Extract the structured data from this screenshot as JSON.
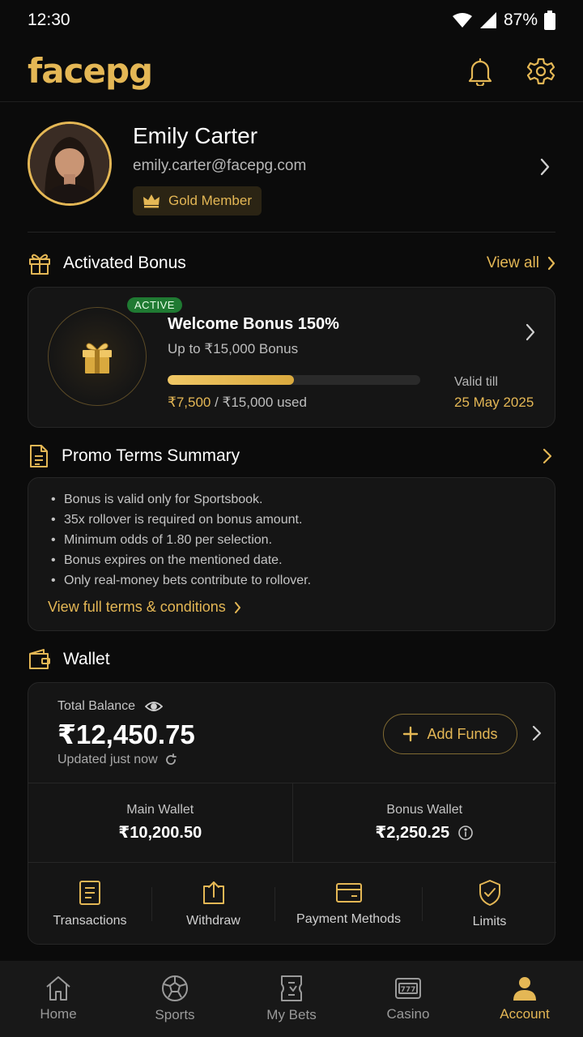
{
  "status": {
    "time": "12:30",
    "battery": "87%"
  },
  "header": {
    "logo": "facepg"
  },
  "profile": {
    "name": "Emily Carter",
    "email": "emily.carter@facepg.com",
    "badge": "Gold Member"
  },
  "activated_bonus": {
    "title": "Activated Bonus",
    "view_all": "View all",
    "status": "ACTIVE",
    "name": "Welcome Bonus 150%",
    "subtitle": "Up to ₹15,000 Bonus",
    "progress": 0.5,
    "used": "₹7,500",
    "total": " / ₹15,000 used",
    "valid_label": "Valid till",
    "valid_date": "25 May 2025"
  },
  "promo_terms": {
    "title": "Promo Terms Summary",
    "items": [
      "Bonus is valid only for Sportsbook.",
      "35x rollover is required on bonus amount.",
      "Minimum odds of 1.80 per selection.",
      "Bonus expires on the mentioned date.",
      "Only real-money bets contribute to rollover."
    ],
    "link": "View full terms & conditions"
  },
  "wallet": {
    "title": "Wallet",
    "total_label": "Total Balance",
    "total_value": "₹12,450.75",
    "updated": "Updated just now",
    "add_funds": "Add Funds",
    "main_label": "Main Wallet",
    "main_value": "₹10,200.50",
    "bonus_label": "Bonus Wallet",
    "bonus_value": "₹2,250.25",
    "actions": [
      "Transactions",
      "Withdraw",
      "Payment Methods",
      "Limits"
    ]
  },
  "nav": {
    "items": [
      "Home",
      "Sports",
      "My Bets",
      "Casino",
      "Account"
    ],
    "active": "Account"
  },
  "colors": {
    "accent": "#e4b755",
    "background": "#0b0b0b",
    "active_badge": "#1f7a32"
  }
}
